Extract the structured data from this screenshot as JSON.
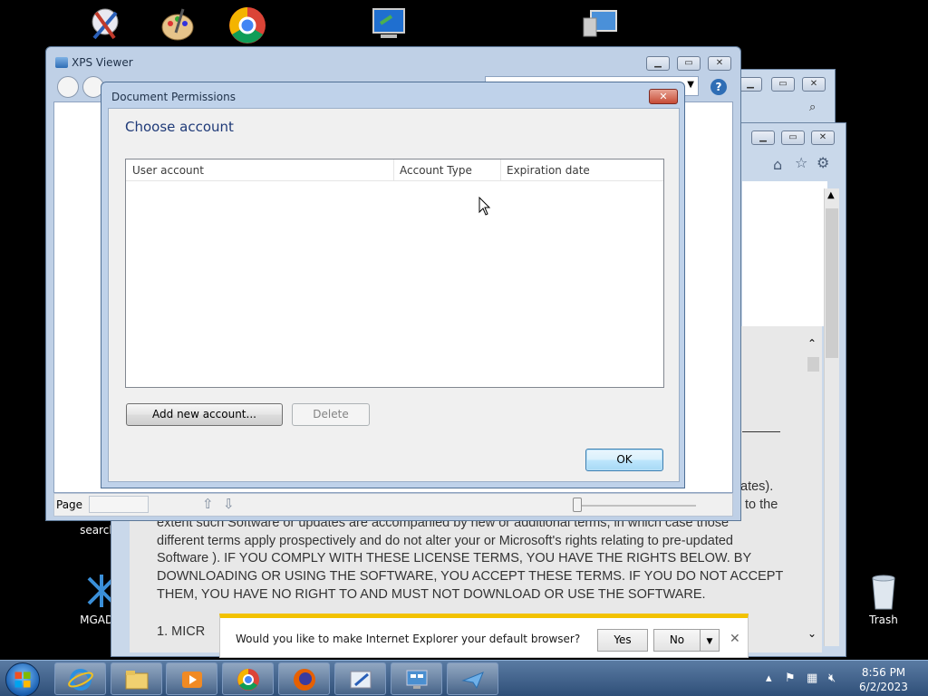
{
  "desktop": {
    "icons": [
      {
        "label": "search"
      },
      {
        "label": "MGADia"
      },
      {
        "label": "Trash"
      }
    ]
  },
  "ie": {
    "legal_lines": [
      "extent such Software or updates are accompanied by new or additional terms, in which case those",
      "different terms apply prospectively and do not alter your or Microsoft's rights relating to pre-updated",
      "Software ). IF YOU COMPLY WITH THESE LICENSE TERMS, YOU HAVE THE RIGHTS BELOW. BY",
      "DOWNLOADING OR USING THE SOFTWARE, YOU ACCEPT THESE TERMS. IF YOU DO NOT ACCEPT",
      "THEM, YOU HAVE NO RIGHT TO AND MUST NOT DOWNLOAD OR USE THE SOFTWARE."
    ],
    "list_item": "1.    MICR",
    "frag_right_1": "ates).",
    "frag_right_2": "to the"
  },
  "xps": {
    "title": "XPS Viewer",
    "page_label": "Page"
  },
  "dialog": {
    "title": "Document Permissions",
    "close_label": "✕",
    "heading": "Choose account",
    "columns": [
      "User account",
      "Account Type",
      "Expiration date"
    ],
    "add_button": "Add new account...",
    "delete_button": "Delete",
    "ok_button": "OK"
  },
  "notification": {
    "message": "Would you like to make Internet Explorer your default browser?",
    "yes": "Yes",
    "no": "No",
    "close": "✕"
  },
  "taskbar": {
    "time": "8:56 PM",
    "date": "6/2/2023"
  }
}
